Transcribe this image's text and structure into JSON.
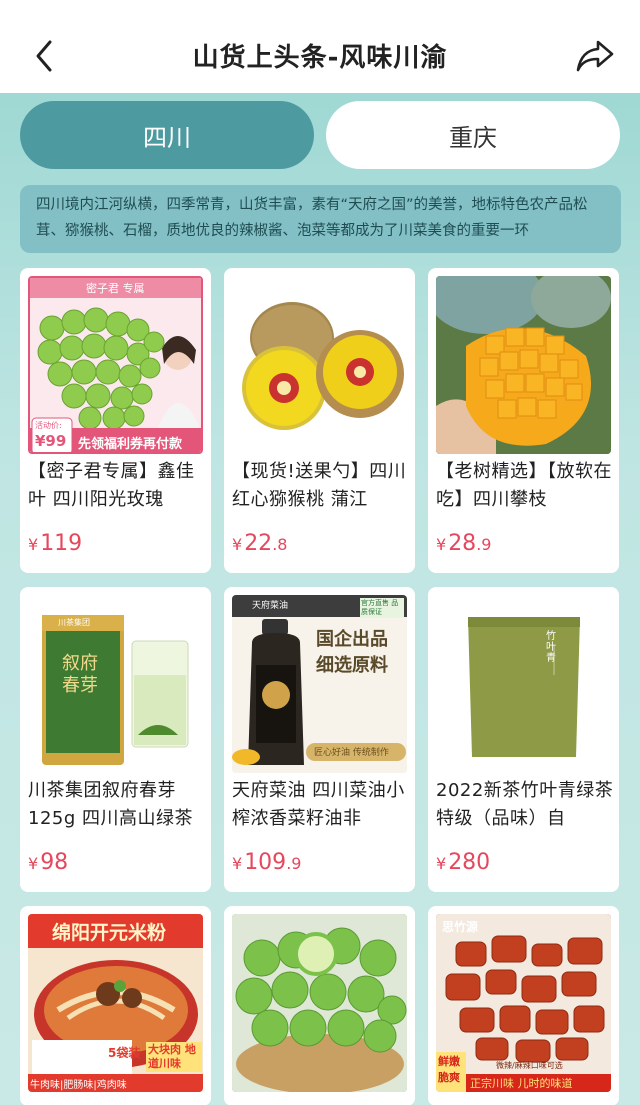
{
  "header": {
    "title": "山货上头条-风味川渝"
  },
  "tabs": [
    {
      "label": "四川",
      "active": true
    },
    {
      "label": "重庆",
      "active": false
    }
  ],
  "intro": "四川境内江河纵横，四季常青，山货丰富，素有“天府之国”的美誉，地标特色农产品松茸、猕猴桃、石榴，质地优良的辣椒酱、泡菜等都成为了川菜美食的重要一环",
  "products": [
    {
      "name": "【密子君专属】鑫佳叶 四川阳光玫瑰",
      "price_int": "119",
      "price_dec": "",
      "img": {
        "banner": "密子君 专属",
        "tag_label": "活动价:",
        "tag_price": "¥99",
        "coupon": "先领福利券再付款"
      }
    },
    {
      "name": "【现货!送果勺】四川红心猕猴桃 蒲江",
      "price_int": "22",
      "price_dec": ".8"
    },
    {
      "name": "【老树精选】【放软在吃】四川攀枝",
      "price_int": "28",
      "price_dec": ".9"
    },
    {
      "name": "川茶集团叙府春芽125g 四川高山绿茶",
      "price_int": "98",
      "price_dec": "",
      "img": {
        "brand": "川茶集团",
        "can_text": "叙府春芽"
      }
    },
    {
      "name": "天府菜油 四川菜油小榨浓香菜籽油非",
      "price_int": "109",
      "price_dec": ".9",
      "img": {
        "brand": "天府菜油",
        "badge": "官方直售 品质保证",
        "headline1": "国企出品",
        "headline2": "细选原料",
        "sub": "匠心好油 传统制作"
      }
    },
    {
      "name": "2022新茶竹叶青绿茶特级（品味）自",
      "price_int": "280",
      "price_dec": "",
      "img": {
        "brand": "竹叶青"
      }
    },
    {
      "name": "",
      "price_int": "",
      "price_dec": "",
      "img": {
        "headline": "绵阳开元米粉",
        "pack": "5袋装",
        "tag": "大块肉 地道川味",
        "flavors": "牛肉味|肥肠味|鸡肉味"
      }
    },
    {
      "name": "",
      "price_int": "",
      "price_dec": ""
    },
    {
      "name": "",
      "price_int": "",
      "price_dec": "",
      "img": {
        "brand": "思竹源",
        "side": "鲜嫩 脆爽",
        "tag": "微辣/麻辣口味可选",
        "slogan": "正宗川味 儿时的味道"
      }
    }
  ],
  "colors": {
    "accent": "#4e9aa1",
    "price": "#e5485d",
    "background": "#bfe5e2"
  },
  "icons": {
    "back": "chevron-left-icon",
    "share": "share-arrow-icon"
  }
}
